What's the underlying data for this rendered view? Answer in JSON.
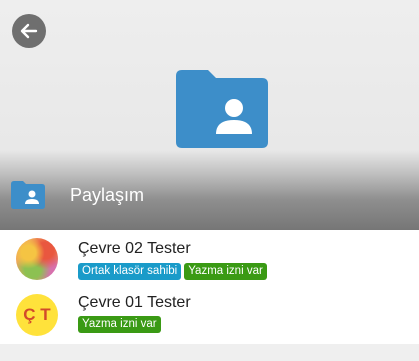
{
  "header": {
    "back_icon": "arrow-left-icon",
    "hero_icon": "shared-folder-icon",
    "folder_color": "#3d8ec9"
  },
  "section": {
    "icon": "shared-folder-icon",
    "title": "Paylaşım"
  },
  "members": [
    {
      "name": "Çevre 02 Tester",
      "avatar": "photo",
      "badges": [
        {
          "label": "Ortak klasör sahibi",
          "color": "#1a9bc9"
        },
        {
          "label": "Yazma izni var",
          "color": "#3a9a14"
        }
      ]
    },
    {
      "name": "Çevre 01 Tester",
      "avatar_initials": "ÇT",
      "avatar_color": "#ffe23b",
      "badges": [
        {
          "label": "Yazma izni var",
          "color": "#3a9a14"
        }
      ]
    }
  ]
}
